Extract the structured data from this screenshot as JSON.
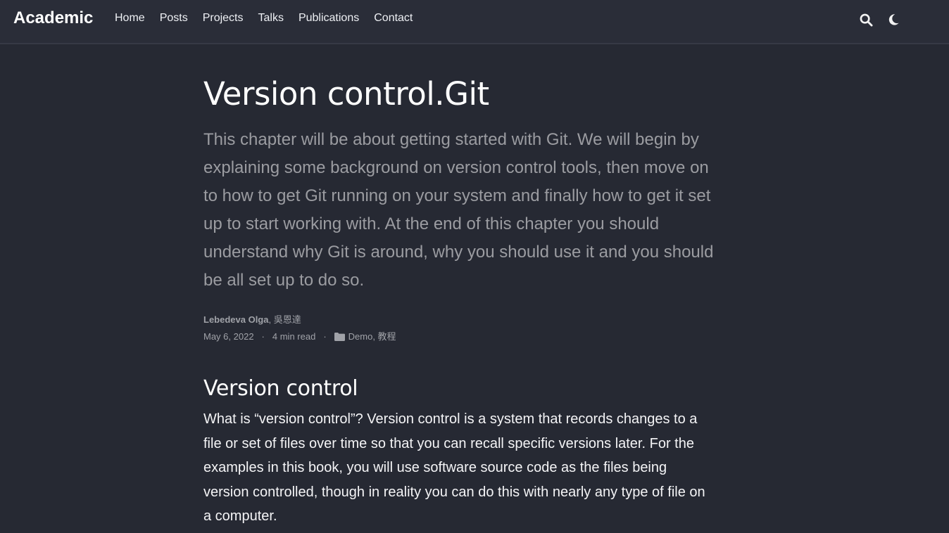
{
  "navbar": {
    "brand": "Academic",
    "links": [
      "Home",
      "Posts",
      "Projects",
      "Talks",
      "Publications",
      "Contact"
    ],
    "icons": [
      "search-icon",
      "moon-icon"
    ]
  },
  "article": {
    "title": "Version control.Git",
    "summary": "This chapter will be about getting started with Git. We will begin by explaining some background on version control tools, then move on to how to get Git running on your system and finally how to get it set up to start working with. At the end of this chapter you should understand why Git is around, why you should use it and you should be all set up to do so.",
    "authors": {
      "primary": "Lebedeva Olga",
      "separator": ", ",
      "secondary": "吳恩達"
    },
    "meta": {
      "date": "May 6, 2022",
      "separator": "·",
      "reading_time": "4 min read",
      "categories": "Demo, 教程",
      "category_icon": "folder-icon"
    },
    "sections": [
      {
        "heading": "Version control",
        "body": "What is “version control”? Version control is a system that records changes to a file or set of files over time so that you can recall specific versions later. For the examples in this book, you will use software source code as the files being version controlled, though in reality you can do this with nearly any type of file on a computer."
      }
    ]
  },
  "colors": {
    "background": "#262933",
    "navbar": "#2a2d38",
    "summary_text": "#9b9ca1",
    "meta_text": "#a0a2a8"
  }
}
